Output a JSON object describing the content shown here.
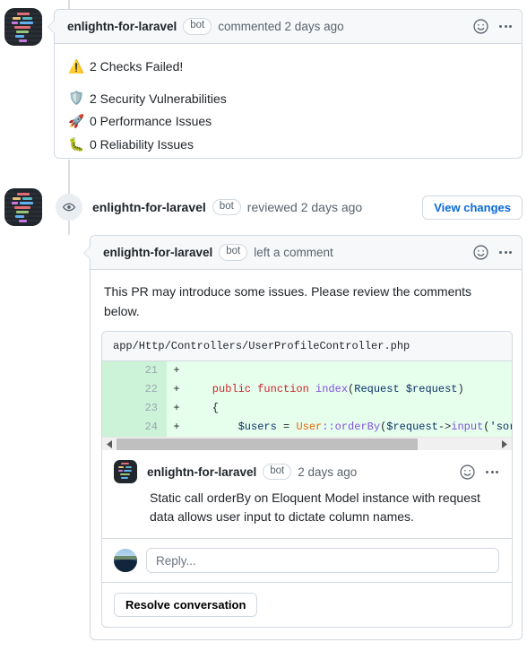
{
  "timeline": {
    "first_comment": {
      "author": "enlightn-for-laravel",
      "bot_label": "bot",
      "action": "commented 2 days ago",
      "reaction_icon": "smiley-icon",
      "menu_icon": "kebab-menu-icon",
      "headline": {
        "emoji": "⚠️",
        "emoji_name": "warning-emoji",
        "text": "2 Checks Failed!"
      },
      "checks": [
        {
          "emoji": "🛡️",
          "emoji_name": "shield-emoji",
          "text": "2 Security Vulnerabilities"
        },
        {
          "emoji": "🚀",
          "emoji_name": "rocket-emoji",
          "text": "0 Performance Issues"
        },
        {
          "emoji": "🐛",
          "emoji_name": "bug-emoji",
          "text": "0 Reliability Issues"
        }
      ]
    },
    "review_event": {
      "icon": "eye-icon",
      "author": "enlightn-for-laravel",
      "bot_label": "bot",
      "action": "reviewed 2 days ago",
      "view_changes_label": "View changes"
    },
    "review_comment": {
      "author": "enlightn-for-laravel",
      "bot_label": "bot",
      "action": "left a comment",
      "reaction_icon": "smiley-icon",
      "menu_icon": "kebab-menu-icon",
      "body": "This PR may introduce some issues. Please review the comments below."
    },
    "diff_thread": {
      "file_path": "app/Http/Controllers/UserProfileController.php",
      "lines": [
        {
          "number": "21",
          "sign": "+",
          "code_plain": ""
        },
        {
          "number": "22",
          "sign": "+",
          "code_plain": "    public function index(Request $request)"
        },
        {
          "number": "23",
          "sign": "+",
          "code_plain": "    {"
        },
        {
          "number": "24",
          "sign": "+",
          "code_plain": "        $users = User::orderBy($request->input('sortBy"
        }
      ],
      "scrollbar": {
        "left_arrow": "scroll-left-arrow-icon",
        "right_arrow": "scroll-right-arrow-icon"
      },
      "inline_comment": {
        "author": "enlightn-for-laravel",
        "bot_label": "bot",
        "timestamp": "2 days ago",
        "reaction_icon": "smiley-icon",
        "menu_icon": "kebab-menu-icon",
        "body": "Static call orderBy on Eloquent Model instance with request data allows user input to dictate column names."
      },
      "reply": {
        "placeholder": "Reply...",
        "avatar": "user-avatar"
      },
      "resolve_label": "Resolve conversation"
    }
  },
  "colors": {
    "accent_link": "#0969da",
    "diff_add_bg": "#e6ffec",
    "diff_add_gutter": "#ccf2d7",
    "border": "#d1d9e0",
    "header_bg": "#f6f8fa",
    "muted_text": "#59636e"
  }
}
